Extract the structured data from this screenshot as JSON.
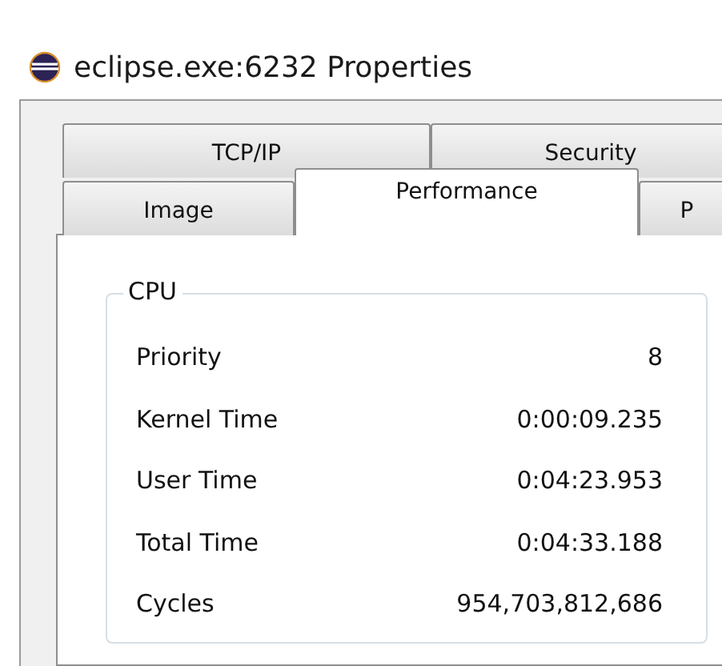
{
  "window": {
    "title": "eclipse.exe:6232 Properties"
  },
  "tab_rows": [
    {
      "tabs": [
        {
          "label": "TCP/IP",
          "selected": false
        },
        {
          "label": "Security",
          "selected": false
        }
      ]
    },
    {
      "tabs": [
        {
          "label": "Image",
          "selected": false
        },
        {
          "label": "Performance",
          "selected": true
        },
        {
          "label": "P",
          "selected": false
        }
      ]
    }
  ],
  "cpu_group": {
    "title": "CPU",
    "rows": [
      {
        "label": "Priority",
        "value": "8"
      },
      {
        "label": "Kernel Time",
        "value": "0:00:09.235"
      },
      {
        "label": "User Time",
        "value": "0:04:23.953"
      },
      {
        "label": "Total Time",
        "value": "0:04:33.188"
      },
      {
        "label": "Cycles",
        "value": "954,703,812,686"
      }
    ]
  }
}
